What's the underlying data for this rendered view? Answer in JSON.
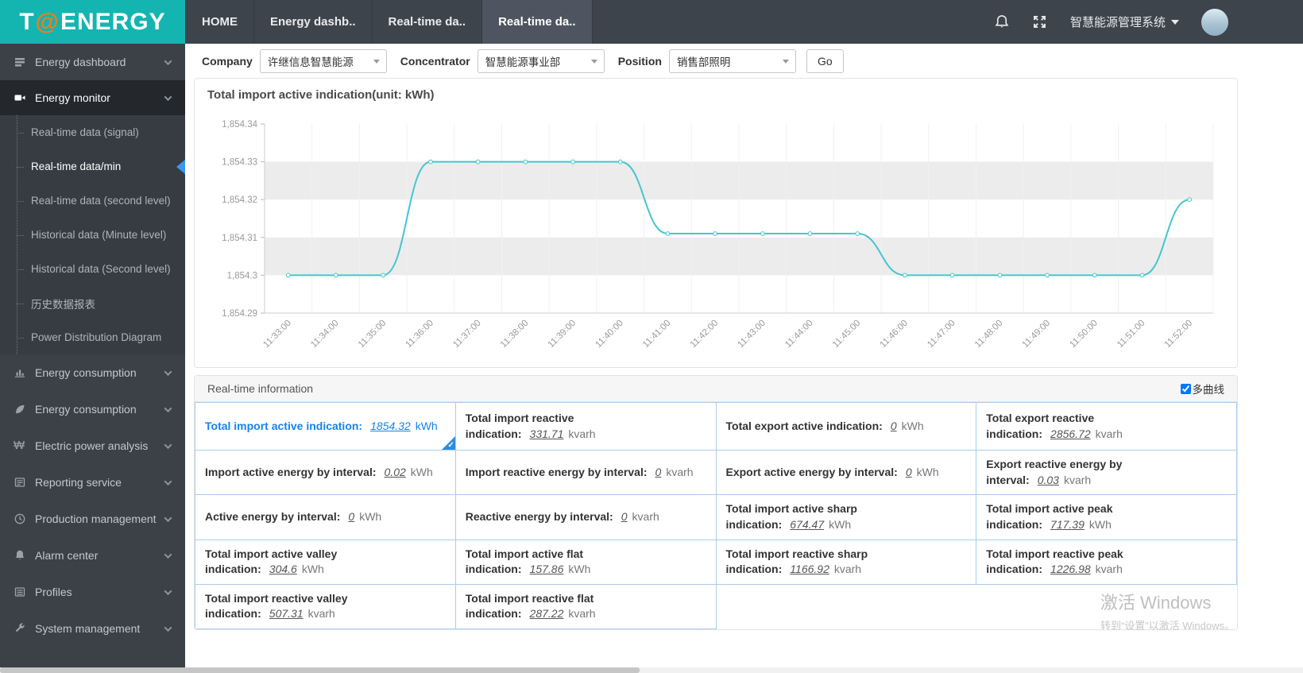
{
  "colors": {
    "brand_teal": "#14b5b1",
    "logo_orange": "#f07d1c",
    "link_blue": "#1584e8",
    "table_border_blue": "#a9cdec",
    "line_teal": "#45c6cf"
  },
  "header": {
    "logo_part1": "T",
    "logo_at": "@",
    "logo_part2": "ENERGY",
    "tabs": [
      {
        "label": "HOME"
      },
      {
        "label": "Energy dashb.."
      },
      {
        "label": "Real-time da.."
      },
      {
        "label": "Real-time da.."
      }
    ],
    "system_menu": "智慧能源管理系统"
  },
  "sidebar": {
    "items": [
      {
        "label": "Energy dashboard"
      },
      {
        "label": "Energy monitor",
        "submenu": [
          {
            "label": "Real-time data (signal)"
          },
          {
            "label": "Real-time data/min"
          },
          {
            "label": "Real-time data (second level)"
          },
          {
            "label": "Historical data (Minute level)"
          },
          {
            "label": "Historical data (Second level)"
          },
          {
            "label": "历史数据报表"
          },
          {
            "label": "Power Distribution Diagram"
          }
        ]
      },
      {
        "label": "Energy consumption"
      },
      {
        "label": "Energy consumption"
      },
      {
        "label": "Electric power analysis"
      },
      {
        "label": "Reporting service"
      },
      {
        "label": "Production management"
      },
      {
        "label": "Alarm center"
      },
      {
        "label": "Profiles"
      },
      {
        "label": "System management"
      }
    ]
  },
  "filters": {
    "company_label": "Company",
    "company_value": "许继信息智慧能源",
    "concentrator_label": "Concentrator",
    "concentrator_value": "智慧能源事业部",
    "position_label": "Position",
    "position_value": "销售部照明",
    "go_label": "Go"
  },
  "chart_data": {
    "type": "line",
    "title": "Total import active indication(unit:  kWh)",
    "x": [
      "11:33:00",
      "11:34:00",
      "11:35:00",
      "11:36:00",
      "11:37:00",
      "11:38:00",
      "11:39:00",
      "11:40:00",
      "11:41:00",
      "11:42:00",
      "11:43:00",
      "11:44:00",
      "11:45:00",
      "11:46:00",
      "11:47:00",
      "11:48:00",
      "11:49:00",
      "11:50:00",
      "11:51:00",
      "11:52:00"
    ],
    "series": [
      {
        "name": "Total import active indication",
        "values": [
          1854.3,
          1854.3,
          1854.3,
          1854.33,
          1854.33,
          1854.33,
          1854.33,
          1854.33,
          1854.311,
          1854.311,
          1854.311,
          1854.311,
          1854.311,
          1854.3,
          1854.3,
          1854.3,
          1854.3,
          1854.3,
          1854.3,
          1854.32
        ]
      }
    ],
    "xlabel": "",
    "ylabel": "",
    "ylim": [
      1854.29,
      1854.34
    ],
    "ytick": 0.01,
    "grid": true,
    "legend": "none",
    "line_color": "#45c6cf",
    "band_color": "#ececec"
  },
  "realtime": {
    "title": "Real-time information",
    "multi_curve_label": "多曲线",
    "multi_curve_checked": true,
    "rows": [
      {
        "cells": [
          {
            "label": "Total import active indication:",
            "value": "1854.32",
            "unit": "kWh"
          },
          {
            "label": "Total import reactive indication:",
            "value": "331.71",
            "unit": "kvarh"
          },
          {
            "label": "Total export active indication:",
            "value": "0",
            "unit": "kWh"
          },
          {
            "label": "Total export reactive indication:",
            "value": "2856.72",
            "unit": "kvarh"
          }
        ]
      },
      {
        "cells": [
          {
            "label": "Import active energy by interval:",
            "value": "0.02",
            "unit": "kWh"
          },
          {
            "label": "Import reactive energy by interval:",
            "value": "0",
            "unit": "kvarh"
          },
          {
            "label": "Export active energy by interval:",
            "value": "0",
            "unit": "kWh"
          },
          {
            "label": "Export reactive energy by interval:",
            "value": "0.03",
            "unit": "kvarh"
          }
        ]
      },
      {
        "cells": [
          {
            "label": "Active energy by interval:",
            "value": "0",
            "unit": "kWh"
          },
          {
            "label": "Reactive energy by interval:",
            "value": "0",
            "unit": "kvarh"
          },
          {
            "label": "Total import active sharp indication:",
            "value": "674.47",
            "unit": "kWh"
          },
          {
            "label": "Total import active peak indication:",
            "value": "717.39",
            "unit": "kWh"
          }
        ]
      },
      {
        "cells": [
          {
            "label": "Total import active valley indication:",
            "value": "304.6",
            "unit": "kWh"
          },
          {
            "label": "Total import active flat indication:",
            "value": "157.86",
            "unit": "kWh"
          },
          {
            "label": "Total import reactive sharp indication:",
            "value": "1166.92",
            "unit": "kvarh"
          },
          {
            "label": "Total import reactive peak indication:",
            "value": "1226.98",
            "unit": "kvarh"
          }
        ]
      },
      {
        "cells": [
          {
            "label": "Total import reactive valley indication:",
            "value": "507.31",
            "unit": "kvarh"
          },
          {
            "label": "Total import reactive flat indication:",
            "value": "287.22",
            "unit": "kvarh"
          },
          {
            "label": "",
            "value": "",
            "unit": ""
          },
          {
            "label": "",
            "value": "",
            "unit": ""
          }
        ]
      }
    ]
  },
  "watermark": {
    "line1": "激活 Windows",
    "line2": "转到“设置”以激活 Windows。"
  }
}
